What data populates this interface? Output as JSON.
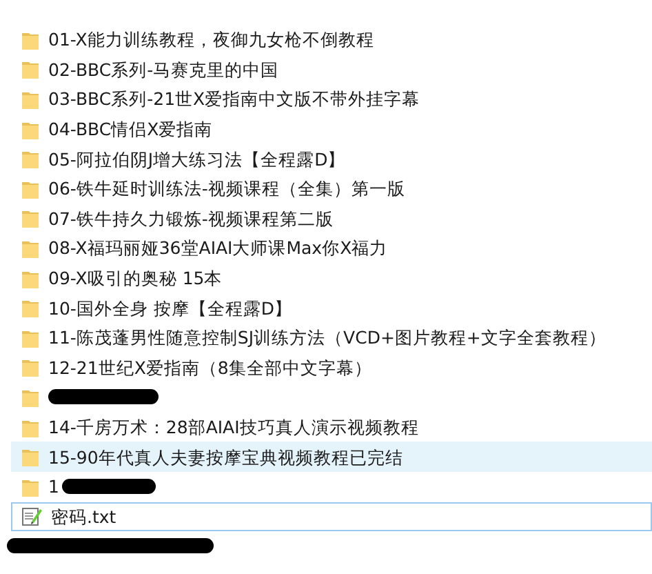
{
  "items": [
    {
      "kind": "folder",
      "name": "01-X能力训练教程，夜御九女枪不倒教程",
      "hovered": false,
      "focused": false,
      "redacted": false
    },
    {
      "kind": "folder",
      "name": "02-BBC系列-马赛克里的中国",
      "hovered": false,
      "focused": false,
      "redacted": false
    },
    {
      "kind": "folder",
      "name": "03-BBC系列-21世X爱指南中文版不带外挂字幕",
      "hovered": false,
      "focused": false,
      "redacted": false
    },
    {
      "kind": "folder",
      "name": "04-BBC情侣X爱指南",
      "hovered": false,
      "focused": false,
      "redacted": false
    },
    {
      "kind": "folder",
      "name": "05-阿拉伯阴J增大练习法【全程露D】",
      "hovered": false,
      "focused": false,
      "redacted": false
    },
    {
      "kind": "folder",
      "name": "06-铁牛延时训练法-视频课程（全集）第一版",
      "hovered": false,
      "focused": false,
      "redacted": false
    },
    {
      "kind": "folder",
      "name": "07-铁牛持久力锻炼-视频课程第二版",
      "hovered": false,
      "focused": false,
      "redacted": false
    },
    {
      "kind": "folder",
      "name": "08-X福玛丽娅36堂AIAI大师课Max你X福力",
      "hovered": false,
      "focused": false,
      "redacted": false
    },
    {
      "kind": "folder",
      "name": "09-X吸引的奥秘 15本",
      "hovered": false,
      "focused": false,
      "redacted": false
    },
    {
      "kind": "folder",
      "name": "10-国外全身  按摩【全程露D】",
      "hovered": false,
      "focused": false,
      "redacted": false
    },
    {
      "kind": "folder",
      "name": "11-陈茂蓬男性随意控制SJ训练方法（VCD+图片教程+文字全套教程）",
      "hovered": false,
      "focused": false,
      "redacted": false
    },
    {
      "kind": "folder",
      "name": "12-21世纪X爱指南（8集全部中文字幕）",
      "hovered": false,
      "focused": false,
      "redacted": false
    },
    {
      "kind": "folder",
      "hovered": false,
      "focused": false,
      "redacted": true
    },
    {
      "kind": "folder",
      "name": "14-千房万术：28部AIAI技巧真人演示视频教程",
      "hovered": false,
      "focused": false,
      "redacted": false
    },
    {
      "kind": "folder",
      "name": "15-90年代真人夫妻按摩宝典视频教程已完结",
      "hovered": true,
      "focused": false,
      "redacted": false
    },
    {
      "kind": "folder",
      "name": "1",
      "hovered": false,
      "focused": false,
      "redacted": true
    },
    {
      "kind": "text",
      "name": "密码.txt",
      "hovered": false,
      "focused": true,
      "redacted": false
    },
    {
      "kind": "blank",
      "hovered": false,
      "focused": false,
      "redacted": true
    }
  ]
}
